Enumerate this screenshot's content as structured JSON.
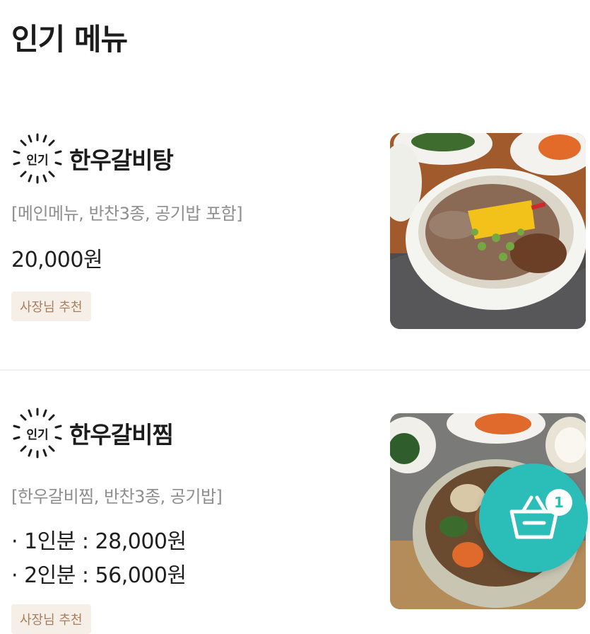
{
  "header": {
    "title": "인기 메뉴"
  },
  "menu_items": [
    {
      "badge": "인기",
      "name": "한우갈비탕",
      "description": "[메인메뉴, 반찬3종, 공기밥 포함]",
      "prices": [
        "20,000원"
      ],
      "recommendation": "사장님 추천",
      "image_alt": "galbitang-photo"
    },
    {
      "badge": "인기",
      "name": "한우갈비찜",
      "description": "[한우갈비찜, 반찬3종, 공기밥]",
      "prices": [
        "· 1인분 : 28,000원",
        "· 2인분 : 56,000원"
      ],
      "recommendation": "사장님 추천",
      "image_alt": "galbijjim-photo"
    }
  ],
  "cart": {
    "count": "1",
    "icon": "basket-icon",
    "color": "#2bbdb7"
  },
  "colors": {
    "badge_bg": "#f5efe8",
    "badge_text": "#a77e5e",
    "description": "#8e8e8e"
  }
}
